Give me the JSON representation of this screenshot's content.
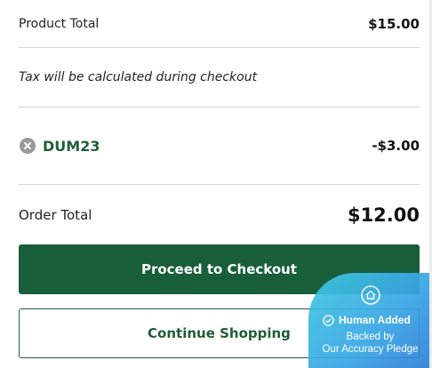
{
  "summary": {
    "product_total_label": "Product Total",
    "product_total_value": "$15.00",
    "tax_note": "Tax will be calculated during checkout",
    "coupon": {
      "code": "DUM23",
      "discount": "-$3.00",
      "remove_icon": "close-circle-icon"
    },
    "order_total_label": "Order Total",
    "order_total_value": "$12.00"
  },
  "actions": {
    "checkout_label": "Proceed to Checkout",
    "continue_label": "Continue Shopping"
  },
  "badge": {
    "icon": "shield-home-icon",
    "title": "Human Added",
    "line1": "Backed by",
    "line2": "Our Accuracy Pledge"
  },
  "colors": {
    "brand_green": "#195e3a",
    "coupon_green": "#1e5e3a",
    "badge_blue": "#3aa8e6"
  }
}
